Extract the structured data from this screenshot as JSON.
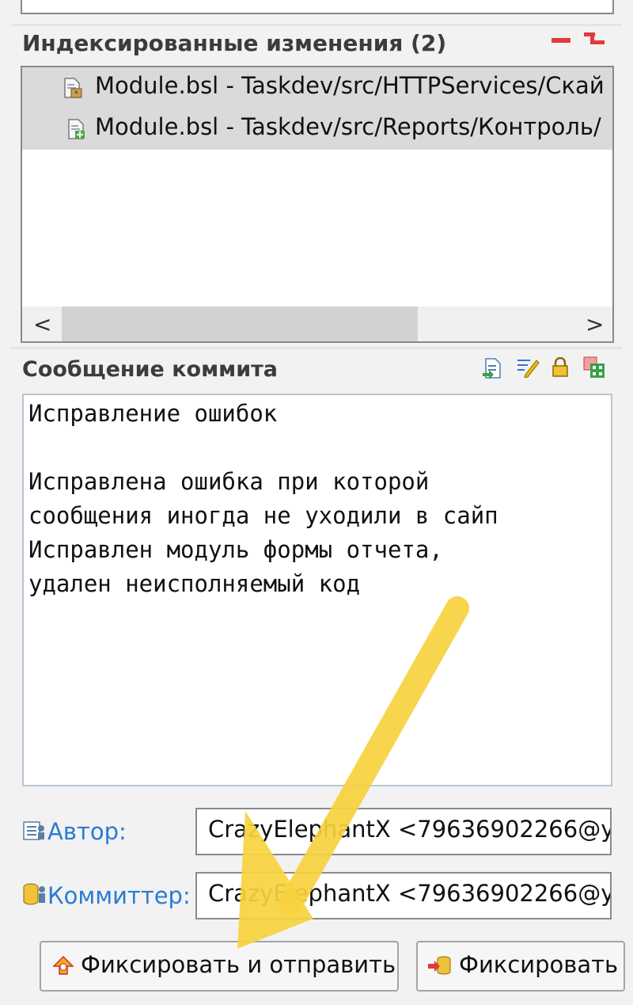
{
  "staged": {
    "title": "Индексированные изменения (2)",
    "items": [
      {
        "label": "Module.bsl - Taskdev/src/HTTPServices/Скай",
        "icon": "modified-file-icon"
      },
      {
        "label": "Module.bsl - Taskdev/src/Reports/Контроль/",
        "icon": "added-file-icon"
      }
    ],
    "toolbar": [
      "remove-icon",
      "remove-all-icon"
    ],
    "scroll_left": "<",
    "scroll_right": ">"
  },
  "commit": {
    "title": "Сообщение коммита",
    "toolbar": [
      "compare-icon",
      "edit-icon",
      "sign-off-icon",
      "change-id-icon"
    ],
    "message_lines": [
      "Исправление ошибок",
      "",
      "Исправлена ошибка при которой",
      "сообщения иногда не уходили в сайп",
      "Исправлен модуль формы отчета,",
      "удален неисполняемый код"
    ]
  },
  "author": {
    "label": "Автор:",
    "value": "CrazyElephantX <79636902266@y"
  },
  "committer": {
    "label": "Коммиттер:",
    "value": "CrazyElephantX <79636902266@y"
  },
  "buttons": {
    "commit_push": "Фиксировать и отправить",
    "commit": "Фиксировать"
  },
  "colors": {
    "accent_label": "#2a7bd4",
    "overlay_arrow": "#f7d23e"
  }
}
